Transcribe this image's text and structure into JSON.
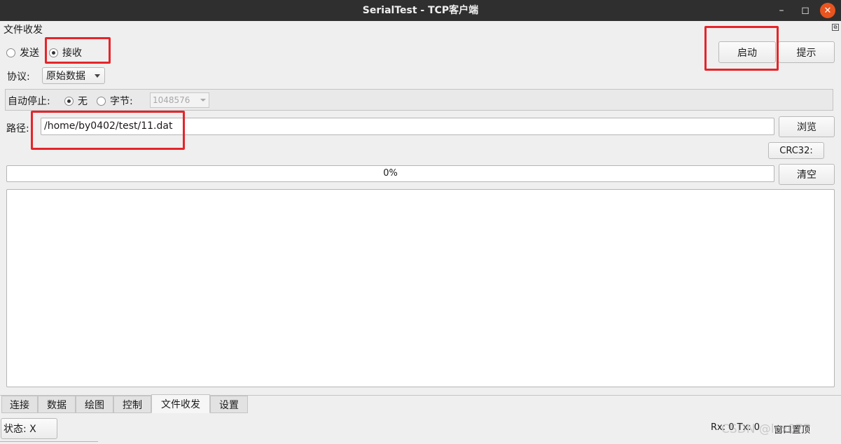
{
  "window": {
    "title": "SerialTest - TCP客户端",
    "min_icon": "minimize-icon",
    "max_icon": "maximize-icon",
    "close_icon": "close-icon"
  },
  "group": {
    "title": "文件收发"
  },
  "mode": {
    "send_label": "发送",
    "receive_label": "接收",
    "selected": "接收"
  },
  "buttons": {
    "start_label": "启动",
    "hint_label": "提示",
    "browse_label": "浏览",
    "crc_label": "CRC32:",
    "clear_label": "清空"
  },
  "protocol": {
    "label": "协议:",
    "selected": "原始数据"
  },
  "auto_stop": {
    "label": "自动停止:",
    "none_label": "无",
    "bytes_label": "字节:",
    "bytes_value": "1048576",
    "selected": "无"
  },
  "path": {
    "label": "路径:",
    "value": "/home/by0402/test/11.dat"
  },
  "progress": {
    "text": "0%",
    "value": 0
  },
  "tabs": [
    {
      "label": "连接",
      "active": false
    },
    {
      "label": "数据",
      "active": false
    },
    {
      "label": "绘图",
      "active": false
    },
    {
      "label": "控制",
      "active": false
    },
    {
      "label": "文件收发",
      "active": true
    },
    {
      "label": "设置",
      "active": false
    }
  ],
  "status": {
    "state_label": "状态: X",
    "rx_tx": "Rx: 0  Tx: 0",
    "pin_label": "窗口置顶",
    "watermark": "CSDN @lcx077"
  },
  "colors": {
    "highlight": "#e5252a",
    "titlebar": "#2f2f2f",
    "close": "#e9541f"
  }
}
